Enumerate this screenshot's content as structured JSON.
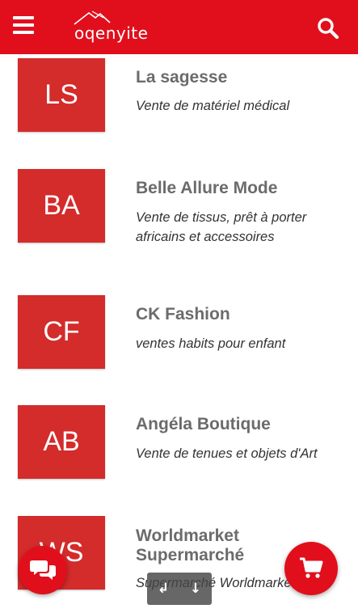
{
  "header": {
    "logo_text": "oqenyite",
    "menu_icon": "hamburger-menu-icon",
    "search_icon": "search-icon",
    "background": "#e10f1c"
  },
  "shops": [
    {
      "initials": "LS",
      "name": "La sagesse",
      "description": "Vente de matériel médical"
    },
    {
      "initials": "BA",
      "name": "Belle Allure Mode",
      "description": "Vente de tissus, prêt à porter africains et accessoires"
    },
    {
      "initials": "CF",
      "name": "CK Fashion",
      "description": "ventes habits pour enfant"
    },
    {
      "initials": "AB",
      "name": "Angéla Boutique",
      "description": "Vente de tenues et objets d'Art"
    },
    {
      "initials": "WS",
      "name": "Worldmarket Supermarché",
      "description": "Supermarché Worldmarket"
    }
  ],
  "floating": {
    "chat_icon": "chat-bubbles-icon",
    "cart_icon": "shopping-cart-icon",
    "scroll_up_icon": "arrow-down-left-icon",
    "scroll_down_icon": "arrow-down-icon",
    "scroll_up_glyph": "↲",
    "scroll_down_glyph": "↓"
  },
  "colors": {
    "accent": "#e10f1c",
    "tile": "#d42b2b",
    "shop_name": "#6b6b6b"
  }
}
